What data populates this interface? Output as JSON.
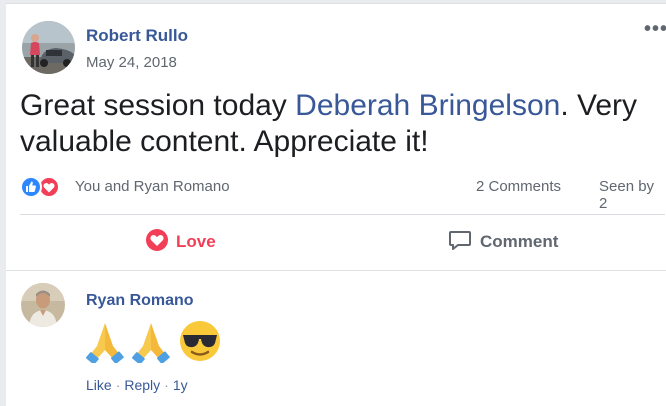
{
  "post": {
    "author": "Robert Rullo",
    "date": "May 24, 2018",
    "more_icon": "•••",
    "text_before": "Great session today ",
    "mention": "Deberah Bringelson",
    "text_after": ". Very valuable content. Appreciate it!",
    "reaction_icons": [
      "like-icon",
      "love-icon"
    ],
    "reaction_names": "You and Ryan Romano",
    "comment_count": "2 Comments",
    "seen_by": "Seen by 2"
  },
  "actions": {
    "love_label": "Love",
    "comment_label": "Comment"
  },
  "comment": {
    "author": "Ryan Romano",
    "emojis": [
      "folded-hands-icon",
      "folded-hands-icon",
      "sunglasses-face-icon"
    ],
    "like_label": "Like",
    "reply_label": "Reply",
    "separator": "·",
    "age": "1y"
  },
  "colors": {
    "link": "#385898",
    "love": "#f33e58",
    "like": "#2d88ff",
    "secondary_text": "#606770"
  }
}
